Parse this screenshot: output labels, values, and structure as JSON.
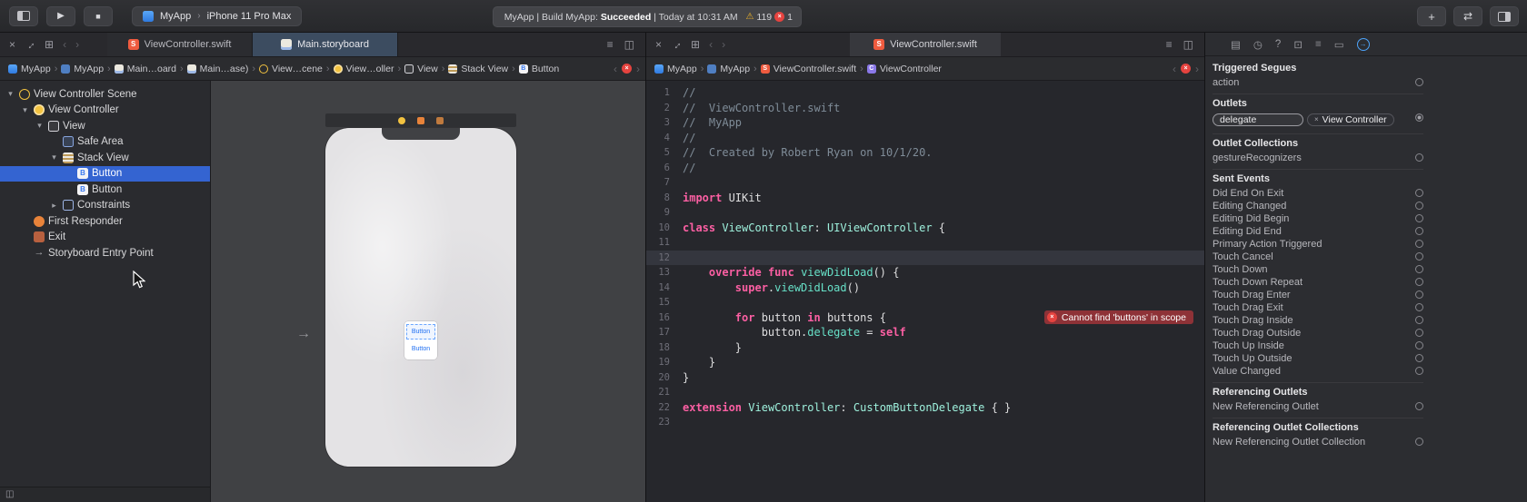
{
  "toolbar": {
    "scheme": {
      "target": "MyApp",
      "device": "iPhone 11 Pro Max"
    },
    "status": {
      "prefix": "MyApp | Build MyApp: ",
      "result": "Succeeded",
      "time": " | Today at 10:31 AM",
      "warning_count": "119",
      "error_count": "1"
    }
  },
  "left_editor": {
    "tabs": [
      {
        "label": "ViewController.swift",
        "icon": "swift"
      },
      {
        "label": "Main.storyboard",
        "icon": "storyboard"
      }
    ],
    "breadcrumbs": [
      {
        "label": "MyApp",
        "icon": "app"
      },
      {
        "label": "MyApp",
        "icon": "folder"
      },
      {
        "label": "Main…oard",
        "icon": "storyboard"
      },
      {
        "label": "Main…ase)",
        "icon": "storyboard"
      },
      {
        "label": "View…cene",
        "icon": "scene"
      },
      {
        "label": "View…oller",
        "icon": "vc"
      },
      {
        "label": "View",
        "icon": "view"
      },
      {
        "label": "Stack View",
        "icon": "stack"
      },
      {
        "label": "Button",
        "icon": "button"
      }
    ],
    "outline": {
      "rows": [
        {
          "label": "View Controller Scene",
          "indent": 0,
          "icon": "scene",
          "disclosure": "open"
        },
        {
          "label": "View Controller",
          "indent": 1,
          "icon": "vc",
          "disclosure": "open"
        },
        {
          "label": "View",
          "indent": 2,
          "icon": "view",
          "disclosure": "open"
        },
        {
          "label": "Safe Area",
          "indent": 3,
          "icon": "safearea"
        },
        {
          "label": "Stack View",
          "indent": 3,
          "icon": "stack",
          "disclosure": "open"
        },
        {
          "label": "Button",
          "indent": 4,
          "icon": "button",
          "selected": true
        },
        {
          "label": "Button",
          "indent": 4,
          "icon": "button"
        },
        {
          "label": "Constraints",
          "indent": 3,
          "icon": "constraints",
          "disclosure": "closed"
        },
        {
          "label": "First Responder",
          "indent": 1,
          "icon": "firstresponder"
        },
        {
          "label": "Exit",
          "indent": 1,
          "icon": "exit"
        },
        {
          "label": "Storyboard Entry Point",
          "indent": 1,
          "icon": "entry"
        }
      ]
    },
    "canvas": {
      "stack_buttons": [
        "Button",
        "Button"
      ]
    }
  },
  "right_editor": {
    "tab": {
      "label": "ViewController.swift",
      "icon": "swift"
    },
    "breadcrumbs": [
      {
        "label": "MyApp",
        "icon": "app"
      },
      {
        "label": "MyApp",
        "icon": "folder"
      },
      {
        "label": "ViewController.swift",
        "icon": "swift"
      },
      {
        "label": "ViewController",
        "icon": "class"
      }
    ],
    "code": {
      "current_line": 12,
      "error_line": 16,
      "error_message": "Cannot find 'buttons' in scope",
      "lines": [
        {
          "n": 1,
          "tokens": [
            [
              "c",
              "//"
            ]
          ]
        },
        {
          "n": 2,
          "tokens": [
            [
              "c",
              "//  ViewController.swift"
            ]
          ]
        },
        {
          "n": 3,
          "tokens": [
            [
              "c",
              "//  MyApp"
            ]
          ]
        },
        {
          "n": 4,
          "tokens": [
            [
              "c",
              "//"
            ]
          ]
        },
        {
          "n": 5,
          "tokens": [
            [
              "c",
              "//  Created by Robert Ryan on 10/1/20."
            ]
          ]
        },
        {
          "n": 6,
          "tokens": [
            [
              "c",
              "//"
            ]
          ]
        },
        {
          "n": 7,
          "tokens": []
        },
        {
          "n": 8,
          "tokens": [
            [
              "k",
              "import"
            ],
            [
              "p",
              " UIKit"
            ]
          ]
        },
        {
          "n": 9,
          "tokens": []
        },
        {
          "n": 10,
          "tokens": [
            [
              "k",
              "class"
            ],
            [
              "p",
              " "
            ],
            [
              "t",
              "ViewController"
            ],
            [
              "p",
              ": "
            ],
            [
              "t",
              "UIViewController"
            ],
            [
              "p",
              " {"
            ]
          ]
        },
        {
          "n": 11,
          "tokens": []
        },
        {
          "n": 12,
          "tokens": []
        },
        {
          "n": 13,
          "tokens": [
            [
              "p",
              "    "
            ],
            [
              "k",
              "override"
            ],
            [
              "p",
              " "
            ],
            [
              "k",
              "func"
            ],
            [
              "p",
              " "
            ],
            [
              "f",
              "viewDidLoad"
            ],
            [
              "p",
              "() {"
            ]
          ]
        },
        {
          "n": 14,
          "tokens": [
            [
              "p",
              "        "
            ],
            [
              "k",
              "super"
            ],
            [
              "p",
              "."
            ],
            [
              "f",
              "viewDidLoad"
            ],
            [
              "p",
              "()"
            ]
          ]
        },
        {
          "n": 15,
          "tokens": []
        },
        {
          "n": 16,
          "tokens": [
            [
              "p",
              "        "
            ],
            [
              "k",
              "for"
            ],
            [
              "p",
              " button "
            ],
            [
              "k",
              "in"
            ],
            [
              "p",
              " buttons {"
            ]
          ]
        },
        {
          "n": 17,
          "tokens": [
            [
              "p",
              "            button."
            ],
            [
              "f",
              "delegate"
            ],
            [
              "p",
              " = "
            ],
            [
              "k",
              "self"
            ]
          ]
        },
        {
          "n": 18,
          "tokens": [
            [
              "p",
              "        }"
            ]
          ]
        },
        {
          "n": 19,
          "tokens": [
            [
              "p",
              "    }"
            ]
          ]
        },
        {
          "n": 20,
          "tokens": [
            [
              "p",
              "}"
            ]
          ]
        },
        {
          "n": 21,
          "tokens": []
        },
        {
          "n": 22,
          "tokens": [
            [
              "k",
              "extension"
            ],
            [
              "p",
              " "
            ],
            [
              "t",
              "ViewController"
            ],
            [
              "p",
              ": "
            ],
            [
              "t",
              "CustomButtonDelegate"
            ],
            [
              "p",
              " { }"
            ]
          ]
        },
        {
          "n": 23,
          "tokens": []
        }
      ]
    }
  },
  "inspector": {
    "tools": [
      {
        "name": "file-inspector",
        "glyph": "▤"
      },
      {
        "name": "history-inspector",
        "glyph": "◷"
      },
      {
        "name": "quick-help-inspector",
        "glyph": "?"
      },
      {
        "name": "identity-inspector",
        "glyph": "⊡"
      },
      {
        "name": "attributes-inspector",
        "glyph": "≡"
      },
      {
        "name": "size-inspector",
        "glyph": "▭"
      },
      {
        "name": "connections-inspector",
        "glyph": "→",
        "selected": true
      }
    ],
    "sections": [
      {
        "header": "Triggered Segues",
        "rows": [
          {
            "label": "action"
          }
        ]
      },
      {
        "header": "Outlets",
        "rows": [
          {
            "label": "delegate",
            "connected_to": "View Controller"
          }
        ]
      },
      {
        "header": "Outlet Collections",
        "rows": [
          {
            "label": "gestureRecognizers"
          }
        ]
      },
      {
        "header": "Sent Events",
        "rows": [
          {
            "label": "Did End On Exit"
          },
          {
            "label": "Editing Changed"
          },
          {
            "label": "Editing Did Begin"
          },
          {
            "label": "Editing Did End"
          },
          {
            "label": "Primary Action Triggered"
          },
          {
            "label": "Touch Cancel"
          },
          {
            "label": "Touch Down"
          },
          {
            "label": "Touch Down Repeat"
          },
          {
            "label": "Touch Drag Enter"
          },
          {
            "label": "Touch Drag Exit"
          },
          {
            "label": "Touch Drag Inside"
          },
          {
            "label": "Touch Drag Outside"
          },
          {
            "label": "Touch Up Inside"
          },
          {
            "label": "Touch Up Outside"
          },
          {
            "label": "Value Changed"
          }
        ]
      },
      {
        "header": "Referencing Outlets",
        "rows": [
          {
            "label": "New Referencing Outlet"
          }
        ]
      },
      {
        "header": "Referencing Outlet Collections",
        "rows": [
          {
            "label": "New Referencing Outlet Collection"
          }
        ]
      }
    ]
  }
}
